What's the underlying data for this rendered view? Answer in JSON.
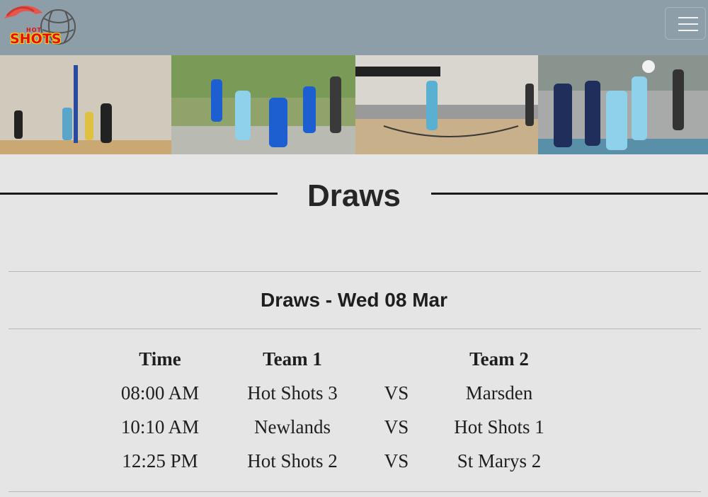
{
  "header": {
    "logo_hot": "HOT",
    "logo_shots": "SHOTS",
    "menu_icon": "hamburger-menu-icon",
    "background": "#8d9ea8"
  },
  "page": {
    "title": "Draws"
  },
  "draws": {
    "heading": "Draws - Wed 08 Mar",
    "columns": [
      "Time",
      "Team 1",
      "",
      "Team 2"
    ],
    "rows": [
      {
        "time": "08:00 AM",
        "team1": "Hot Shots 3",
        "vs": "VS",
        "team2": "Marsden"
      },
      {
        "time": "10:10 AM",
        "team1": "Newlands",
        "vs": "VS",
        "team2": "Hot Shots 1"
      },
      {
        "time": "12:25 PM",
        "team1": "Hot Shots 2",
        "vs": "VS",
        "team2": "St Marys 2"
      }
    ]
  }
}
